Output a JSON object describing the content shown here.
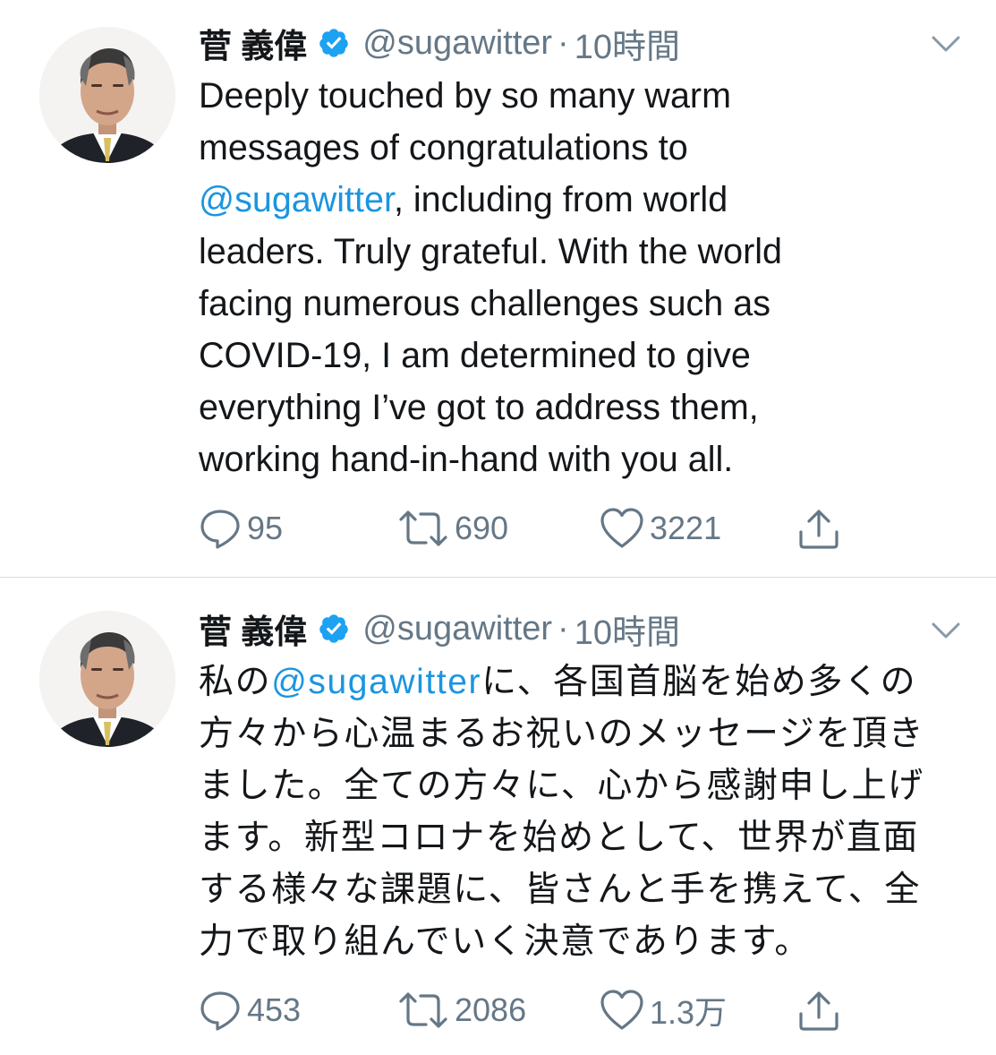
{
  "tweets": [
    {
      "author_name": "菅 義偉",
      "handle": "@sugawitter",
      "separator": "·",
      "time": "10時間",
      "text_lines": [
        [
          {
            "t": "Deeply touched by so many warm"
          }
        ],
        [
          {
            "t": "messages of congratulations to"
          }
        ],
        [
          {
            "t": "@sugawitter",
            "mention": true
          },
          {
            "t": ", including from world"
          }
        ],
        [
          {
            "t": "leaders. Truly grateful. With the world"
          }
        ],
        [
          {
            "t": "facing numerous challenges such as"
          }
        ],
        [
          {
            "t": "COVID-19, I am determined to give"
          }
        ],
        [
          {
            "t": "everything I’ve got to address them,"
          }
        ],
        [
          {
            "t": "working hand-in-hand with you all."
          }
        ]
      ],
      "replies": "95",
      "retweets": "690",
      "likes": "3221"
    },
    {
      "author_name": "菅 義偉",
      "handle": "@sugawitter",
      "separator": "·",
      "time": "10時間",
      "text_lines": [
        [
          {
            "t": "私の"
          },
          {
            "t": "@sugawitter",
            "mention": true
          },
          {
            "t": "に、各国首脳を始め多くの"
          }
        ],
        [
          {
            "t": "方々から心温まるお祝いのメッセージを頂き"
          }
        ],
        [
          {
            "t": "ました。全ての方々に、心から感謝申し上げ"
          }
        ],
        [
          {
            "t": "ます。新型コロナを始めとして、世界が直面"
          }
        ],
        [
          {
            "t": "する様々な課題に、皆さんと手を携えて、全"
          }
        ],
        [
          {
            "t": "力で取り組んでいく決意であります。"
          }
        ]
      ],
      "replies": "453",
      "retweets": "2086",
      "likes": "1.3万"
    }
  ],
  "colors": {
    "text": "#14171a",
    "secondary": "#657786",
    "link": "#1b95e0",
    "verified": "#1da1f2",
    "divider": "#d6dbdf"
  },
  "icons": {
    "verified": "verified-badge-icon",
    "caret": "chevron-down-icon",
    "reply": "reply-bubble-icon",
    "retweet": "retweet-icon",
    "like": "heart-icon",
    "share": "share-icon"
  }
}
